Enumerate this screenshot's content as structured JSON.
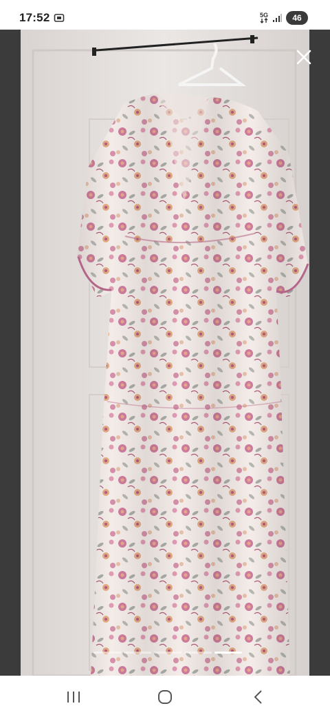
{
  "status_bar": {
    "time": "17:52",
    "screen_icon": "screenshot-icon",
    "network_icon": "5g-network-icon",
    "network_label": "5G",
    "signal_icon": "signal-strength-icon",
    "battery_level": "46"
  },
  "viewer": {
    "close_icon": "close-icon",
    "image_subject": "floral-maxi-dress-on-hanger",
    "page_count": 5,
    "active_page_index": 4,
    "colors": {
      "background": "#3c3b3b",
      "door": "#e6e2df",
      "dress_base": "#f4ece8",
      "print_pink": "#c8698f",
      "print_orange": "#dd9a6d",
      "print_gray": "#8c9390"
    }
  },
  "nav_bar": {
    "recents_icon": "recent-apps-icon",
    "home_icon": "home-icon",
    "back_icon": "back-chevron-icon"
  }
}
